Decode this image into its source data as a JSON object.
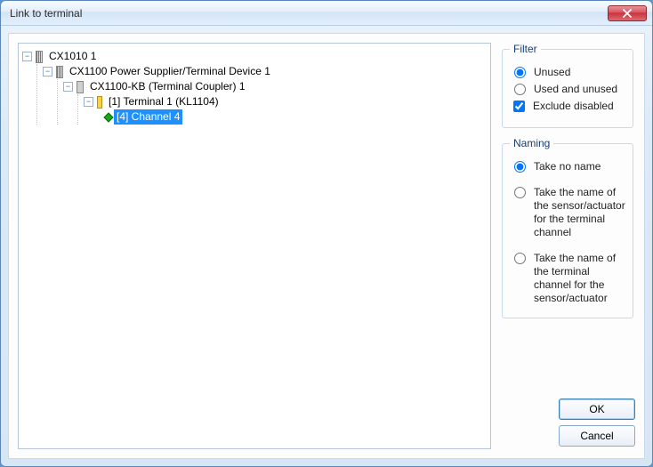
{
  "window": {
    "title": "Link to terminal"
  },
  "tree": {
    "n0": {
      "label": "CX1010 1"
    },
    "n1": {
      "label": "CX1100 Power Supplier/Terminal Device 1"
    },
    "n2": {
      "label": "CX1100-KB (Terminal Coupler) 1"
    },
    "n3": {
      "label": "[1] Terminal 1 (KL1104)"
    },
    "n4": {
      "label": "[4] Channel 4"
    }
  },
  "filter": {
    "legend": "Filter",
    "unused": "Unused",
    "used_and_unused": "Used and unused",
    "exclude_disabled": "Exclude disabled"
  },
  "naming": {
    "legend": "Naming",
    "take_no_name": "Take no name",
    "sensor_for_channel": "Take the name of the sensor/actuator for the terminal channel",
    "channel_for_sensor": "Take the name of the terminal channel for the sensor/actuator"
  },
  "buttons": {
    "ok": "OK",
    "cancel": "Cancel"
  }
}
